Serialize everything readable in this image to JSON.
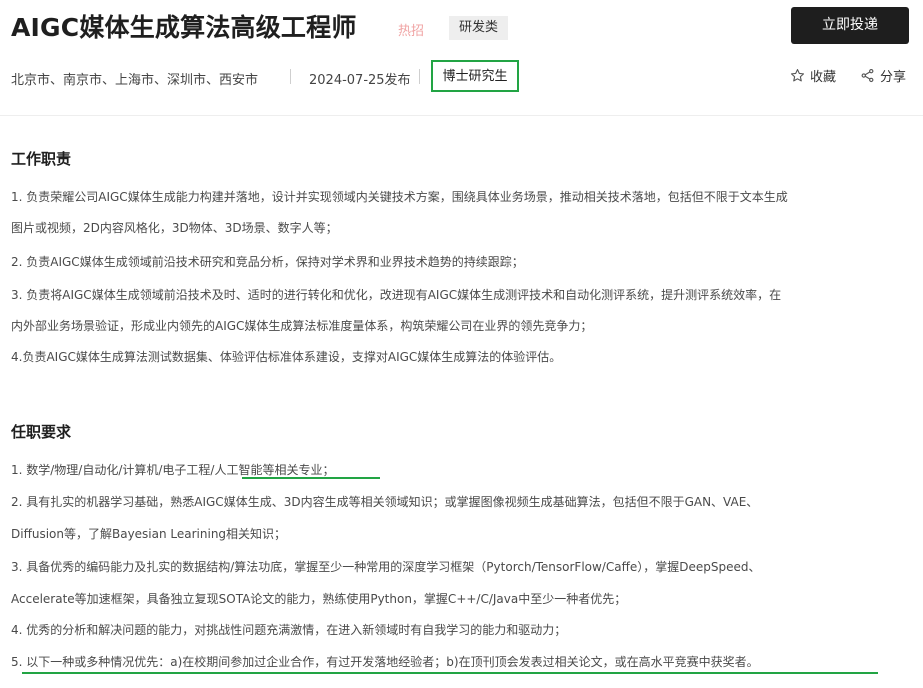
{
  "header": {
    "title": "AIGC媒体生成算法高级工程师",
    "hot_tag": "热招",
    "category_tag": "研发类",
    "apply_button": "立即投递"
  },
  "meta": {
    "locations": "北京市、南京市、上海市、深圳市、西安市",
    "publish_date": "2024-07-25发布",
    "degree": "博士研究生",
    "favorite_label": "收藏",
    "share_label": "分享"
  },
  "duties": {
    "heading": "工作职责",
    "lines": [
      "1. 负责荣耀公司AIGC媒体生成能力构建并落地，设计并实现领域内关键技术方案，围绕具体业务场景，推动相关技术落地，包括但不限于文本生成",
      "图片或视频，2D内容风格化，3D物体、3D场景、数字人等；",
      "2. 负责AIGC媒体生成领域前沿技术研究和竞品分析，保持对学术界和业界技术趋势的持续跟踪；",
      "3. 负责将AIGC媒体生成领域前沿技术及时、适时的进行转化和优化，改进现有AIGC媒体生成测评技术和自动化测评系统，提升测评系统效率，在",
      "内外部业务场景验证，形成业内领先的AIGC媒体生成算法标准度量体系，构筑荣耀公司在业界的领先竞争力；",
      "4.负责AIGC媒体生成算法测试数据集、体验评估标准体系建设，支撑对AIGC媒体生成算法的体验评估。"
    ]
  },
  "requirements": {
    "heading": "任职要求",
    "lines": [
      "1. 数学/物理/自动化/计算机/电子工程/人工智能等相关专业；",
      "2. 具有扎实的机器学习基础，熟悉AIGC媒体生成、3D内容生成等相关领域知识；或掌握图像视频生成基础算法，包括但不限于GAN、VAE、",
      "Diffusion等，了解Bayesian Learining相关知识；",
      "3. 具备优秀的编码能力及扎实的数据结构/算法功底，掌握至少一种常用的深度学习框架（Pytorch/TensorFlow/Caffe），掌握DeepSpeed、",
      "Accelerate等加速框架，具备独立复现SOTA论文的能力，熟练使用Python，掌握C++/C/Java中至少一种者优先；",
      "4. 优秀的分析和解决问题的能力，对挑战性问题充满激情，在进入新领域时有自我学习的能力和驱动力；",
      "5. 以下一种或多种情况优先：a)在校期间参加过企业合作，有过开发落地经验者；b)在顶刊顶会发表过相关论文，或在高水平竞赛中获奖者。"
    ]
  }
}
